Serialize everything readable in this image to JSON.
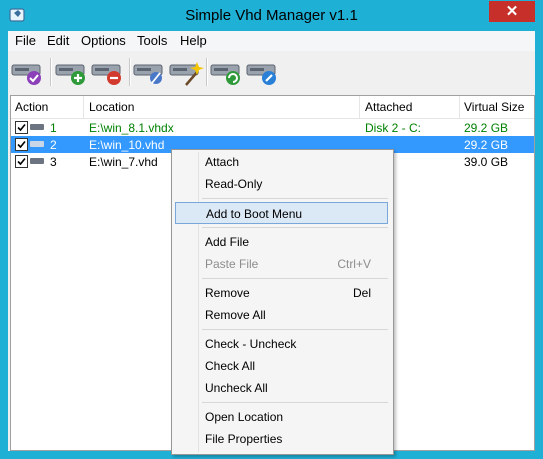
{
  "window": {
    "title": "Simple Vhd Manager v1.1",
    "close_glyph": "✕"
  },
  "menu": [
    "File",
    "Edit",
    "Options",
    "Tools",
    "Help"
  ],
  "toolbar": {
    "icons": [
      "attach-disk-icon",
      "add-disk-icon",
      "remove-disk-icon",
      "edit-disk-icon",
      "magic-disk-icon",
      "refresh-disk-icon",
      "properties-disk-icon"
    ]
  },
  "list": {
    "columns": [
      "Action",
      "Location",
      "Attached",
      "Virtual Size"
    ],
    "rows": [
      {
        "checked": true,
        "num": "1",
        "location": "E:\\win_8.1.vhdx",
        "attached": "Disk 2  -  C:",
        "size": "29.2 GB",
        "selected": false
      },
      {
        "checked": true,
        "num": "2",
        "location": "E:\\win_10.vhd",
        "attached": "",
        "size": "29.2 GB",
        "selected": true
      },
      {
        "checked": true,
        "num": "3",
        "location": "E:\\win_7.vhd",
        "attached": "",
        "size": "39.0 GB",
        "selected": false
      }
    ]
  },
  "context_menu": {
    "attach": "Attach",
    "read_only": "Read-Only",
    "add_to_boot": "Add to Boot Menu",
    "add_file": "Add File",
    "paste_file": "Paste File",
    "paste_shortcut": "Ctrl+V",
    "remove": "Remove",
    "remove_shortcut": "Del",
    "remove_all": "Remove All",
    "check_uncheck": "Check - Uncheck",
    "check_all": "Check All",
    "uncheck_all": "Uncheck All",
    "open_location": "Open Location",
    "file_properties": "File Properties"
  },
  "colors": {
    "title_bar": "#1fb0d6",
    "selection": "#3399ff",
    "close": "#c7302a",
    "green_text": "#008000"
  }
}
